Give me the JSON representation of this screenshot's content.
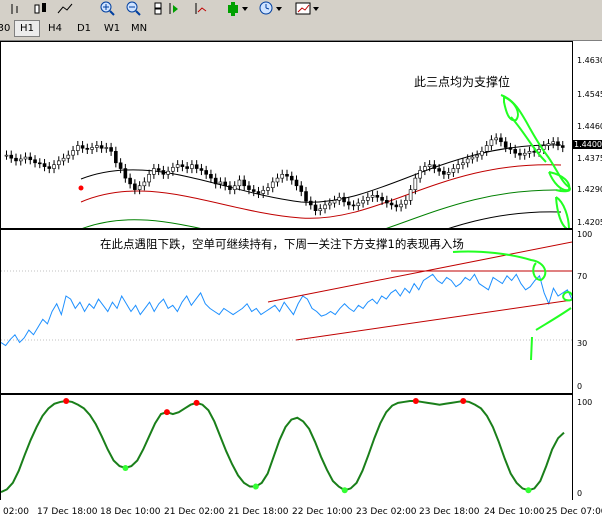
{
  "toolbar": {
    "icons": [
      "chart-bars-icon",
      "candles-icon",
      "line-chart-icon",
      "zoom-in-icon",
      "zoom-out-icon",
      "tile-windows-icon",
      "auto-scroll-icon",
      "chart-shift-icon",
      "indicators-icon",
      "periods-icon",
      "templates-icon"
    ]
  },
  "timeframes": [
    "30",
    "H1",
    "H4",
    "D1",
    "W1",
    "MN"
  ],
  "active_timeframe": "H1",
  "annotations": {
    "support_note": "此三点均为支撑位",
    "rsi_note": "在此点遇阻下跌，空单可继续持有，下周一关注下方支撑1的表现再入场"
  },
  "price_axis": [
    "1.4630",
    "1.4545",
    "1.4460",
    "1.4400",
    "1.4375",
    "1.4290",
    "1.4205"
  ],
  "rsi_axis": [
    "100",
    "70",
    "30",
    "0"
  ],
  "stoch_axis": [
    "100",
    "0"
  ],
  "time_axis": [
    "02:00",
    "17 Dec 18:00",
    "18 Dec 10:00",
    "21 Dec 02:00",
    "21 Dec 18:00",
    "22 Dec 10:00",
    "23 Dec 02:00",
    "23 Dec 18:00",
    "24 Dec 10:00",
    "25 Dec 07:00"
  ],
  "colors": {
    "envelope_outer": "#000000",
    "envelope_red": "#c00000",
    "envelope_green": "#008000",
    "rsi_line": "#1e90ff",
    "trend_channel": "#c00000",
    "stoch_line": "#1a7f1a",
    "stoch_high_dot": "#ff0000",
    "stoch_low_dot": "#33ff33",
    "hand_drawn": "#22ff22",
    "current_price_bg": "#000000"
  },
  "chart_data": [
    {
      "type": "candlestick",
      "title": "",
      "ylim": [
        1.4195,
        1.4665
      ],
      "current_price": "1.4400",
      "close": [
        1.438,
        1.4372,
        1.4365,
        1.437,
        1.4375,
        1.4368,
        1.436,
        1.4358,
        1.435,
        1.4345,
        1.4355,
        1.4365,
        1.4372,
        1.438,
        1.4392,
        1.4405,
        1.4398,
        1.4395,
        1.44,
        1.4405,
        1.4398,
        1.44,
        1.439,
        1.436,
        1.4345,
        1.432,
        1.4305,
        1.429,
        1.43,
        1.431,
        1.433,
        1.4345,
        1.434,
        1.433,
        1.4338,
        1.4348,
        1.4355,
        1.435,
        1.4345,
        1.4355,
        1.4345,
        1.434,
        1.433,
        1.432,
        1.4305,
        1.431,
        1.43,
        1.429,
        1.43,
        1.4315,
        1.43,
        1.429,
        1.4285,
        1.428,
        1.4288,
        1.4295,
        1.431,
        1.432,
        1.433,
        1.4325,
        1.4315,
        1.43,
        1.4285,
        1.426,
        1.425,
        1.4235,
        1.424,
        1.425,
        1.4255,
        1.4262,
        1.427,
        1.4258,
        1.425,
        1.4248,
        1.4255,
        1.4262,
        1.427,
        1.4275,
        1.427,
        1.4262,
        1.4255,
        1.425,
        1.4245,
        1.4252,
        1.4262,
        1.429,
        1.432,
        1.434,
        1.435,
        1.4355,
        1.4345,
        1.4338,
        1.433,
        1.4335,
        1.4345,
        1.4355,
        1.436,
        1.437,
        1.4375,
        1.438,
        1.439,
        1.4405,
        1.442,
        1.4425,
        1.4415,
        1.44,
        1.4395,
        1.4385,
        1.438,
        1.4385,
        1.439,
        1.4388,
        1.4395,
        1.4405,
        1.441,
        1.4415,
        1.4405,
        1.44
      ]
    },
    {
      "type": "line",
      "title": "",
      "ylim": [
        0,
        100
      ],
      "levels": [
        30,
        70
      ],
      "values": [
        30,
        28,
        32,
        35,
        30,
        33,
        38,
        35,
        40,
        45,
        42,
        50,
        55,
        48,
        60,
        58,
        52,
        56,
        50,
        55,
        52,
        58,
        54,
        50,
        56,
        52,
        60,
        55,
        50,
        54,
        48,
        52,
        56,
        50,
        55,
        58,
        52,
        54,
        50,
        56,
        60,
        54,
        58,
        62,
        55,
        52,
        50,
        48,
        52,
        50,
        48,
        50,
        52,
        55,
        50,
        52,
        48,
        50,
        52,
        54,
        50,
        56,
        52,
        48,
        55,
        60,
        58,
        52,
        50,
        47,
        48,
        50,
        48,
        52,
        55,
        52,
        50,
        54,
        52,
        56,
        58,
        55,
        60,
        58,
        62,
        64,
        60,
        65,
        62,
        68,
        64,
        70,
        72,
        74,
        70,
        68,
        72,
        70,
        66,
        68,
        72,
        70,
        74,
        68,
        66,
        64,
        72,
        70,
        68,
        73,
        70,
        74,
        68,
        64,
        66,
        70,
        73,
        62,
        55,
        65,
        60,
        62,
        64,
        58
      ]
    },
    {
      "type": "line",
      "title": "",
      "ylim": [
        0,
        100
      ],
      "values": [
        2,
        5,
        12,
        25,
        42,
        58,
        72,
        84,
        92,
        97,
        99,
        100,
        99,
        96,
        92,
        85,
        75,
        62,
        48,
        36,
        30,
        28,
        30,
        36,
        48,
        62,
        76,
        86,
        88,
        86,
        88,
        92,
        96,
        98,
        96,
        90,
        78,
        62,
        46,
        32,
        20,
        12,
        8,
        8,
        12,
        22,
        40,
        58,
        72,
        80,
        82,
        78,
        70,
        56,
        40,
        26,
        14,
        8,
        4,
        6,
        12,
        25,
        42,
        60,
        76,
        88,
        95,
        98,
        99,
        100,
        100,
        99,
        98,
        97,
        96,
        97,
        98,
        99,
        100,
        99,
        96,
        92,
        84,
        72,
        56,
        38,
        22,
        12,
        6,
        4,
        6,
        14,
        30,
        48,
        60,
        66
      ]
    }
  ]
}
